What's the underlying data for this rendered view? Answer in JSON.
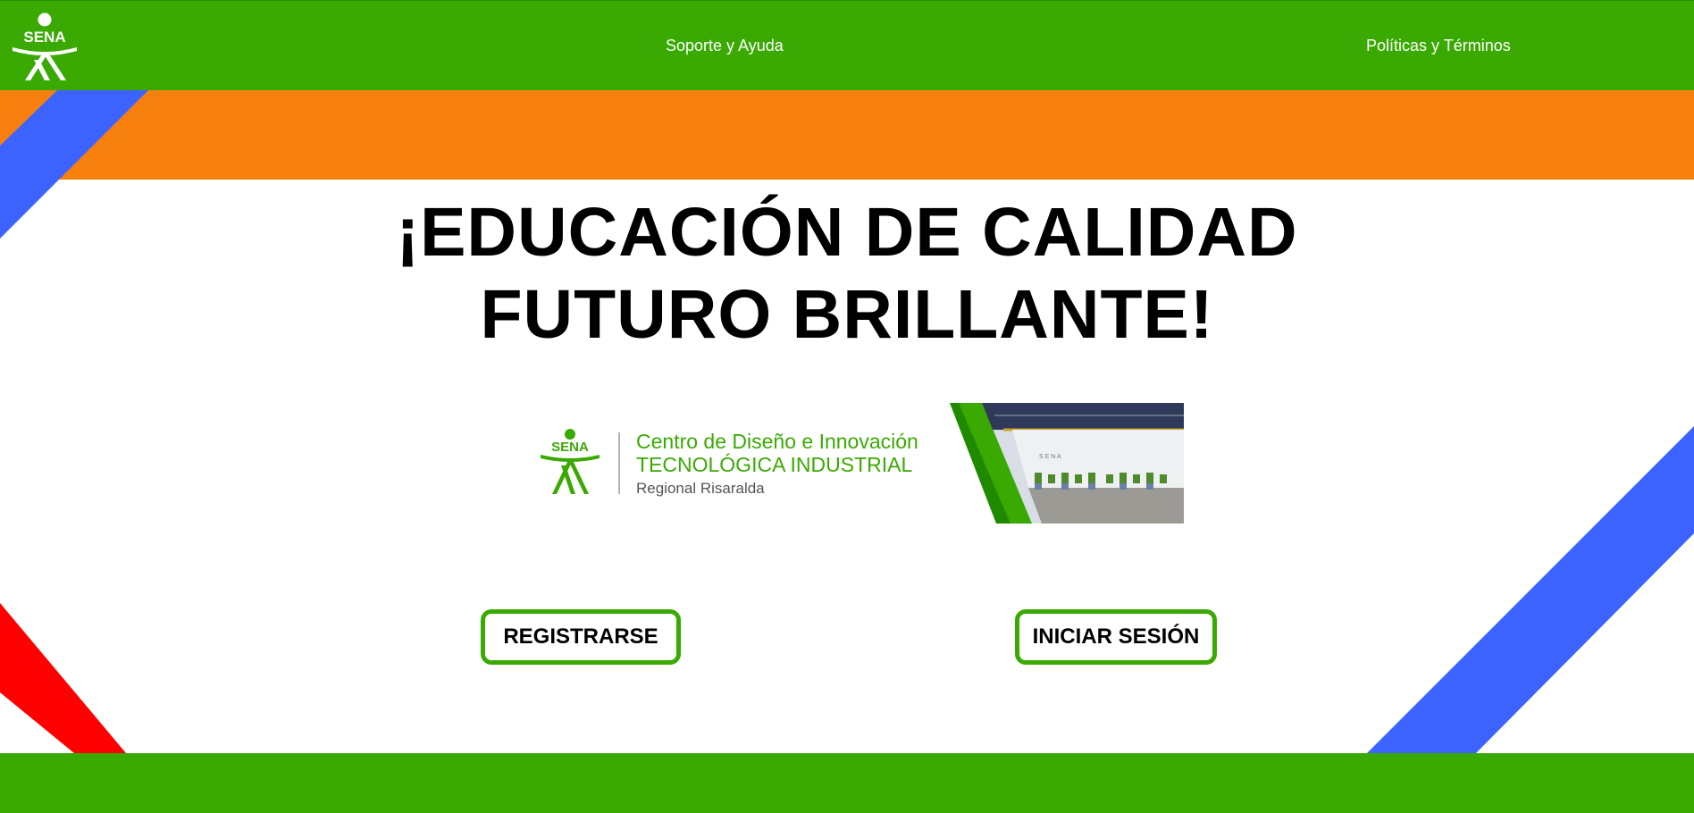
{
  "header": {
    "logo_text": "SENA",
    "nav": {
      "support_label": "Soporte y Ayuda",
      "policies_label": "Políticas y Términos"
    }
  },
  "hero": {
    "line1": "¡EDUCACIÓN DE CALIDAD",
    "line2": "FUTURO BRILLANTE!"
  },
  "banner": {
    "logo_text": "SENA",
    "title_line1": "Centro de Diseño e Innovación",
    "title_line2": "TECNOLÓGICA INDUSTRIAL",
    "subtitle": "Regional Risaralda"
  },
  "actions": {
    "register_label": "REGISTRARSE",
    "login_label": "INICIAR SESIÓN"
  },
  "colors": {
    "green": "#3aaa03",
    "orange": "#f77f0e",
    "blue": "#3d63ff",
    "red": "#ff0000"
  }
}
